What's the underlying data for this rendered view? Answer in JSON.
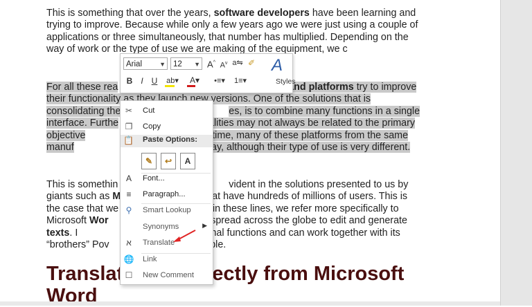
{
  "document": {
    "p1_a": "This is something that over the years, ",
    "p1_b": "software developers",
    "p1_c": " have been learning and trying to improve. Because while only a few years ago we were just using a couple of applications or three simultaneously, that number has multiplied. Depending on the way of work or the type of use we are making of the equipment, we c",
    "p2_a": "For all these rea",
    "p2_b": "grams and platforms",
    "p2_c": " try to improve their functionality as they launch new versions. One of the solutions that is consolidating the",
    "p2_d": "es, is to combine many functions in a single interface. Furthe",
    "p2_e": "nalities may not always be related to the primary objective",
    "p2_f": " the same time, many of these platforms from the same manuf",
    "p2_g": "chronized way, although their type of use is very different.",
    "p3_a": "This is somethin",
    "p3_b": "vident in the solutions presented to us by giants such as ",
    "p3_c": "M",
    "p3_d": "that have hundreds of millions of users. This is the case that we",
    "p3_e": "out in these lines, we refer more specifically to Microsoft ",
    "p3_f": "Wor",
    "p3_g": " widely spread across the globe to edit and generate ",
    "p3_h": "texts",
    "p3_i": ". I",
    "p3_j": "additional functions and can work together with its “brothers” Pov",
    "p3_k": "for example.",
    "heading_a": "Translat",
    "heading_b": "ectly from Microsoft",
    "heading_c": "Word"
  },
  "mini_toolbar": {
    "font": "Arial",
    "size": "12",
    "grow_font": "A",
    "shrink_font": "A",
    "format_painter": "✐",
    "bold": "B",
    "italic": "I",
    "underline": "U",
    "highlight_color": "#f3e400",
    "font_color": "#d11b1b",
    "styles_glyph": "A",
    "styles_label": "Styles"
  },
  "context_menu": {
    "cut": "Cut",
    "copy": "Copy",
    "paste_options": "Paste Options:",
    "font": "Font...",
    "paragraph": "Paragraph...",
    "smart_lookup": "Smart Lookup",
    "synonyms": "Synonyms",
    "translate": "Translate",
    "link": "Link",
    "new_comment": "New Comment"
  },
  "colors": {
    "heading": "#4a0f0f",
    "selection": "#c9c9c9",
    "arrow": "#e02424"
  }
}
